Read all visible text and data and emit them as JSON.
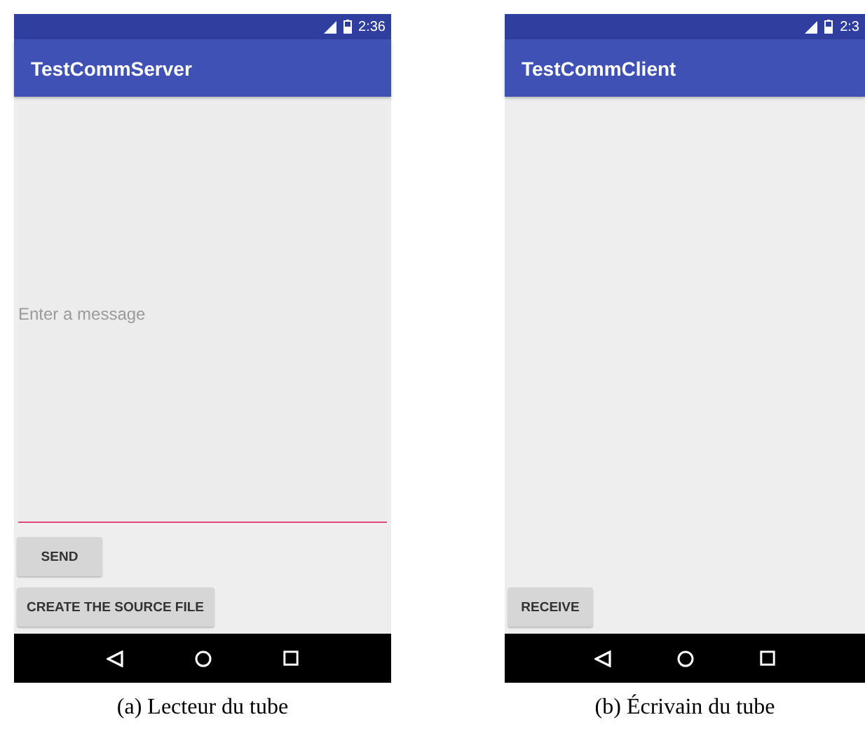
{
  "panels": [
    {
      "status_time": "2:36",
      "title": "TestCommServer",
      "message_field": {
        "placeholder": "Enter a message",
        "focused": true
      },
      "buttons": [
        "SEND",
        "CREATE THE SOURCE FILE"
      ],
      "caption": "(a) Lecteur du tube"
    },
    {
      "status_time": "2:3",
      "title": "TestCommClient",
      "buttons": [
        "RECEIVE"
      ],
      "caption": "(b) Écrivain du tube"
    }
  ]
}
